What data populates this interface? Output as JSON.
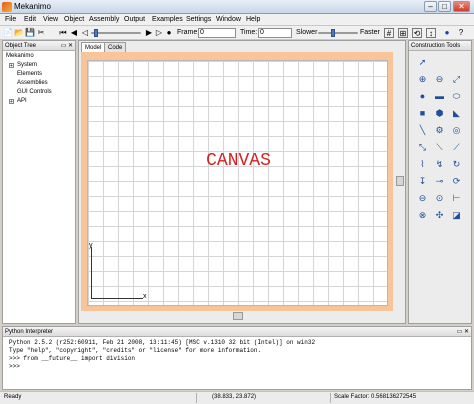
{
  "window": {
    "title": "Mekanimo",
    "minimize": "–",
    "maximize": "□",
    "close": "✕"
  },
  "menu": [
    "File",
    "Edit",
    "View",
    "Object",
    "Assembly",
    "Output",
    "Examples",
    "Settings",
    "Window",
    "Help"
  ],
  "toolbar": {
    "frame_label": "Frame:",
    "frame_value": "0",
    "time_label": "Time:",
    "time_value": "0",
    "slower_label": "Slower",
    "faster_label": "Faster",
    "speed_level": 0.35
  },
  "object_tree": {
    "header": "Object Tree",
    "root": "Mekanimo",
    "items": [
      "System",
      "Elements",
      "Assemblies",
      "GUI Controls",
      "API"
    ]
  },
  "tabs": [
    "Model",
    "Code"
  ],
  "canvas": {
    "label": "CANVAS",
    "axis_y": "y",
    "axis_x": "x"
  },
  "construction_tools": {
    "header": "Construction Tools"
  },
  "python": {
    "header": "Python Interpreter",
    "lines": [
      "Python 2.5.2 (r252:60911, Feb 21 2008, 13:11:45) [MSC v.1310 32 bit (Intel)] on win32",
      "Type \"help\", \"copyright\", \"credits\" or \"license\" for more information.",
      ">>> from __future__ import division",
      ">>>"
    ]
  },
  "status": {
    "left": "Ready",
    "coords": "(38.833, 23.872)",
    "scale": "Scale Factor: 0.568136272545"
  }
}
